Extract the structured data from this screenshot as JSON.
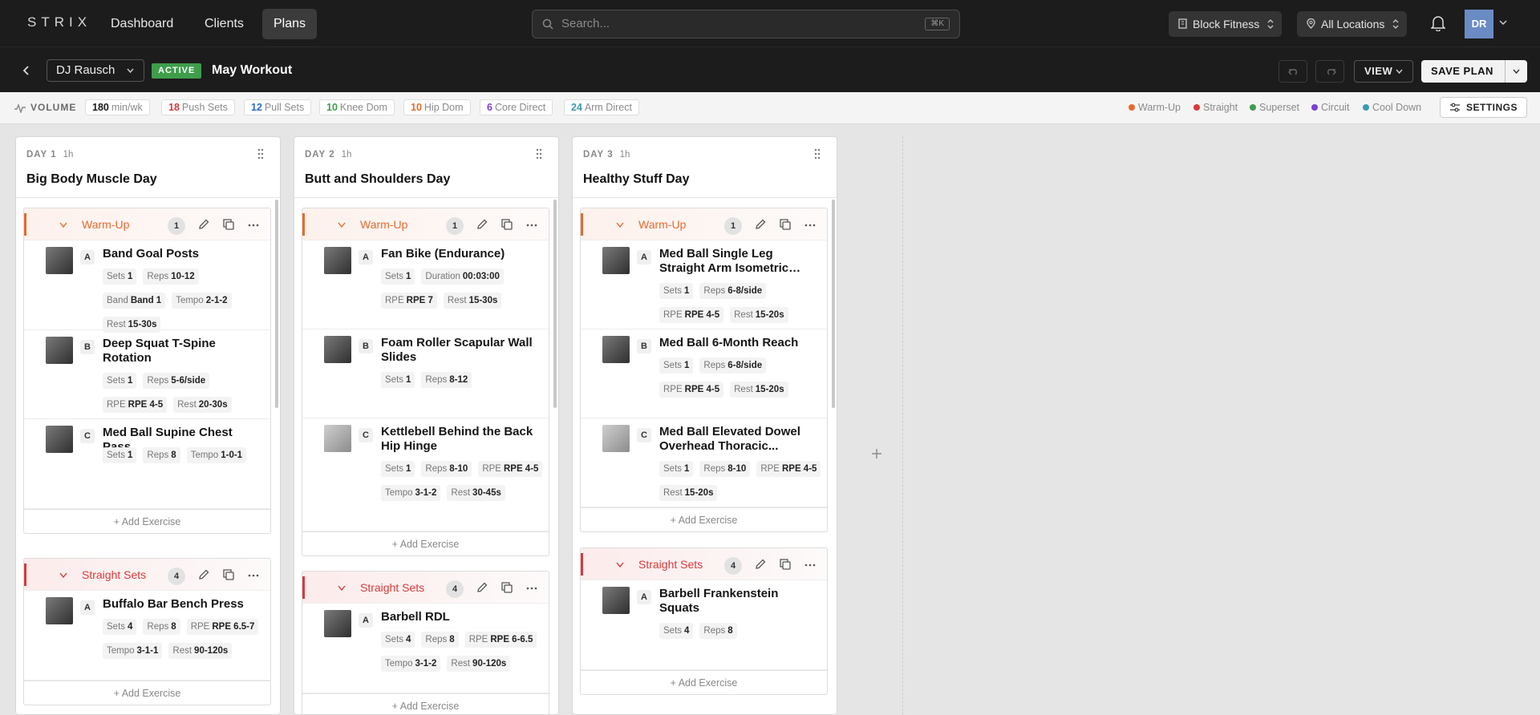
{
  "app": {
    "logo": "STRIX",
    "nav": [
      {
        "label": "Dashboard"
      },
      {
        "label": "Clients"
      },
      {
        "label": "Plans"
      }
    ],
    "search_placeholder": "Search...",
    "search_shortcut": "⌘K",
    "organization": "Block Fitness",
    "location": "All Locations",
    "user_initials": "DR",
    "accent_colors": {
      "warmup": "#e8692e",
      "straight": "#d83a3a",
      "superset": "#3e9e4b",
      "circuit": "#7b3fd0",
      "cooldown": "#3a9ab0"
    }
  },
  "plan": {
    "client": "DJ Rausch",
    "status": "ACTIVE",
    "name": "May Workout",
    "view_label": "VIEW",
    "save_label": "SAVE PLAN"
  },
  "volume": {
    "label": "VOLUME",
    "chips": [
      {
        "value": "180",
        "label": "min/wk",
        "color": "#1a1a1a"
      },
      {
        "value": "18",
        "label": "Push Sets",
        "color": "#d83a3a"
      },
      {
        "value": "12",
        "label": "Pull Sets",
        "color": "#2f6ad0"
      },
      {
        "value": "10",
        "label": "Knee Dom",
        "color": "#3e9e4b"
      },
      {
        "value": "10",
        "label": "Hip Dom",
        "color": "#e8692e"
      },
      {
        "value": "6",
        "label": "Core Direct",
        "color": "#7b3fd0"
      },
      {
        "value": "24",
        "label": "Arm Direct",
        "color": "#3a9ab0"
      }
    ],
    "legend": [
      {
        "label": "Warm-Up",
        "color": "#e8692e"
      },
      {
        "label": "Straight",
        "color": "#d83a3a"
      },
      {
        "label": "Superset",
        "color": "#3e9e4b"
      },
      {
        "label": "Circuit",
        "color": "#7b3fd0"
      },
      {
        "label": "Cool Down",
        "color": "#3a9ab0"
      }
    ],
    "settings_label": "SETTINGS"
  },
  "days": [
    {
      "day_label": "DAY 1",
      "duration": "1h",
      "title": "Big Body Muscle Day",
      "blocks": [
        {
          "type": "Warm-Up",
          "count": "1",
          "add_label": "+ Add Exercise",
          "exercises": [
            {
              "letter": "A",
              "name": "Band Goal Posts",
              "params": [
                [
                  "Sets",
                  "1"
                ],
                [
                  "Reps",
                  "10-12"
                ],
                [
                  "Band",
                  "Band 1"
                ],
                [
                  "Tempo",
                  "2-1-2"
                ],
                [
                  "Rest",
                  "15-30s"
                ]
              ]
            },
            {
              "letter": "B",
              "name": "Deep Squat T-Spine Rotation",
              "params": [
                [
                  "Sets",
                  "1"
                ],
                [
                  "Reps",
                  "5-6/side"
                ],
                [
                  "RPE",
                  "RPE 4-5"
                ],
                [
                  "Rest",
                  "20-30s"
                ]
              ]
            },
            {
              "letter": "C",
              "name": "Med Ball Supine Chest Pass",
              "params": [
                [
                  "Sets",
                  "1"
                ],
                [
                  "Reps",
                  "8"
                ],
                [
                  "Tempo",
                  "1-0-1"
                ]
              ]
            }
          ]
        },
        {
          "type": "Straight Sets",
          "count": "4",
          "add_label": "+ Add Exercise",
          "exercises": [
            {
              "letter": "A",
              "name": "Buffalo Bar Bench Press",
              "params": [
                [
                  "Sets",
                  "4"
                ],
                [
                  "Reps",
                  "8"
                ],
                [
                  "RPE",
                  "RPE 6.5-7"
                ],
                [
                  "Tempo",
                  "3-1-1"
                ],
                [
                  "Rest",
                  "90-120s"
                ]
              ]
            }
          ]
        }
      ]
    },
    {
      "day_label": "DAY 2",
      "duration": "1h",
      "title": "Butt and Shoulders Day",
      "blocks": [
        {
          "type": "Warm-Up",
          "count": "1",
          "add_label": "+ Add Exercise",
          "exercises": [
            {
              "letter": "A",
              "name": "Fan Bike (Endurance)",
              "params": [
                [
                  "Sets",
                  "1"
                ],
                [
                  "Duration",
                  "00:03:00"
                ],
                [
                  "RPE",
                  "RPE 7"
                ],
                [
                  "Rest",
                  "15-30s"
                ]
              ]
            },
            {
              "letter": "B",
              "name": "Foam Roller Scapular Wall Slides",
              "params": [
                [
                  "Sets",
                  "1"
                ],
                [
                  "Reps",
                  "8-12"
                ]
              ]
            },
            {
              "letter": "C",
              "name": "Kettlebell Behind the Back Hip Hinge",
              "params": [
                [
                  "Sets",
                  "1"
                ],
                [
                  "Reps",
                  "8-10"
                ],
                [
                  "RPE",
                  "RPE 4-5"
                ],
                [
                  "Tempo",
                  "3-1-2"
                ],
                [
                  "Rest",
                  "30-45s"
                ]
              ]
            }
          ]
        },
        {
          "type": "Straight Sets",
          "count": "4",
          "add_label": "+ Add Exercise",
          "exercises": [
            {
              "letter": "A",
              "name": "Barbell RDL",
              "params": [
                [
                  "Sets",
                  "4"
                ],
                [
                  "Reps",
                  "8"
                ],
                [
                  "RPE",
                  "RPE 6-6.5"
                ],
                [
                  "Tempo",
                  "3-1-2"
                ],
                [
                  "Rest",
                  "90-120s"
                ]
              ]
            }
          ]
        }
      ]
    },
    {
      "day_label": "DAY 3",
      "duration": "1h",
      "title": "Healthy Stuff Day",
      "blocks": [
        {
          "type": "Warm-Up",
          "count": "1",
          "add_label": "+ Add Exercise",
          "exercises": [
            {
              "letter": "A",
              "name": "Med Ball Single Leg Straight Arm Isometric Balance T-...",
              "params": [
                [
                  "Sets",
                  "1"
                ],
                [
                  "Reps",
                  "6-8/side"
                ],
                [
                  "RPE",
                  "RPE 4-5"
                ],
                [
                  "Rest",
                  "15-20s"
                ]
              ]
            },
            {
              "letter": "B",
              "name": "Med Ball 6-Month Reach",
              "params": [
                [
                  "Sets",
                  "1"
                ],
                [
                  "Reps",
                  "6-8/side"
                ],
                [
                  "RPE",
                  "RPE 4-5"
                ],
                [
                  "Rest",
                  "15-20s"
                ]
              ]
            },
            {
              "letter": "C",
              "name": "Med Ball Elevated Dowel Overhead Thoracic...",
              "params": [
                [
                  "Sets",
                  "1"
                ],
                [
                  "Reps",
                  "8-10"
                ],
                [
                  "RPE",
                  "RPE 4-5"
                ],
                [
                  "Rest",
                  "15-20s"
                ]
              ]
            }
          ]
        },
        {
          "type": "Straight Sets",
          "count": "4",
          "add_label": "+ Add Exercise",
          "exercises": [
            {
              "letter": "A",
              "name": "Barbell Frankenstein Squats",
              "params": [
                [
                  "Sets",
                  "4"
                ],
                [
                  "Reps",
                  "8"
                ]
              ]
            }
          ]
        }
      ]
    }
  ]
}
